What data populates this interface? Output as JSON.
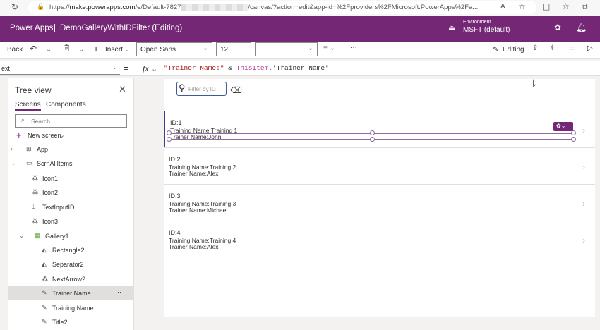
{
  "browser": {
    "url_prefix": "https://",
    "url_host": "make.powerapps.com",
    "url_path1": "/e/Default-7827",
    "url_path2": "/canvas/?action=edit&app-id=%2Fproviders%2FMicrosoft.PowerApps%2Fa..."
  },
  "header": {
    "app": "Power Apps",
    "separator": "|",
    "title": "DemoGalleryWithIDFilter (Editing)",
    "env_label": "Environment",
    "env_value": "MSFT (default)"
  },
  "toolbar": {
    "back": "Back",
    "insert": "Insert",
    "font": "Open Sans",
    "size": "12",
    "more": "···",
    "editing": "Editing"
  },
  "formula": {
    "property": "ext",
    "fx": "fx",
    "parts": [
      "\"Trainer Name:\"",
      " & ",
      "ThisItem",
      ".'Trainer Name'"
    ]
  },
  "tree": {
    "title": "Tree view",
    "tabs": [
      "Screens",
      "Components"
    ],
    "search_placeholder": "Search",
    "new_screen": "New screen",
    "items": [
      {
        "label": "App",
        "icon": "app-icon"
      },
      {
        "label": "ScrnAllItems",
        "icon": "screen-icon"
      },
      {
        "label": "Icon1",
        "icon": "icon-control-icon"
      },
      {
        "label": "Icon2",
        "icon": "icon-control-icon"
      },
      {
        "label": "TextInputID",
        "icon": "text-input-icon"
      },
      {
        "label": "Icon3",
        "icon": "icon-control-icon"
      },
      {
        "label": "Gallery1",
        "icon": "gallery-icon"
      },
      {
        "label": "Rectangle2",
        "icon": "shape-icon"
      },
      {
        "label": "Separator2",
        "icon": "shape-icon"
      },
      {
        "label": "NextArrow2",
        "icon": "icon-control-icon"
      },
      {
        "label": "Trainer Name",
        "icon": "label-icon"
      },
      {
        "label": "Training Name",
        "icon": "label-icon"
      },
      {
        "label": "Title2",
        "icon": "label-icon"
      }
    ],
    "more": "···"
  },
  "canvas": {
    "filter_placeholder": "Filter by ID",
    "rows": [
      {
        "id": "ID:1",
        "training": "Training Name:Training 1",
        "trainer": "Trainer Name:John"
      },
      {
        "id": "ID:2",
        "training": "Training Name:Training 2",
        "trainer": "Trainer Name:Alex"
      },
      {
        "id": "ID:3",
        "training": "Training Name:Training 3",
        "trainer": "Trainer Name:Michael"
      },
      {
        "id": "ID:4",
        "training": "Training Name:Training 4",
        "trainer": "Trainer Name:Alex"
      }
    ]
  },
  "colors": {
    "brand": "#742774",
    "selected": "#e1dfdd"
  }
}
